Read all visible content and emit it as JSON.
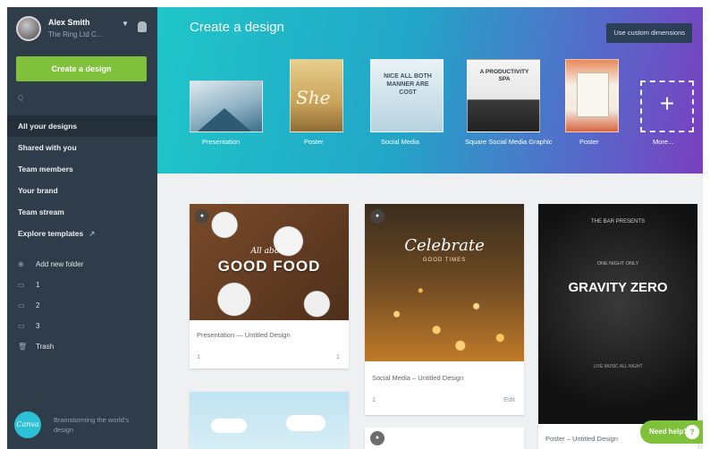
{
  "user": {
    "name": "Alex Smith",
    "team": "The Ring Ltd C..."
  },
  "sidebar": {
    "create_label": "Create a design",
    "search_text": "Q",
    "nav": [
      {
        "label": "All your designs",
        "active": true
      },
      {
        "label": "Shared with you"
      },
      {
        "label": "Team members"
      },
      {
        "label": "Your brand"
      },
      {
        "label": "Team stream"
      },
      {
        "label": "Explore templates",
        "arrow": "↗"
      }
    ],
    "folders": [
      {
        "icon": "⊕",
        "label": "Add new folder"
      },
      {
        "icon": "▭",
        "label": "1"
      },
      {
        "icon": "▭",
        "label": "2"
      },
      {
        "icon": "▭",
        "label": "3"
      },
      {
        "icon": "🗑",
        "label": "Trash"
      }
    ],
    "logo_text": "Canva",
    "promo_text": "Brainstorming the world’s design"
  },
  "header": {
    "title": "Create a design",
    "custom_dimensions_label": "Use custom dimensions",
    "templates": [
      {
        "label": "Presentation"
      },
      {
        "label": "Poster",
        "thumb_text": "She"
      },
      {
        "label": "Social Media",
        "thumb_text": "NICE ALL BOTH MANNER ARE COST"
      },
      {
        "label": "Square Social Media Graphic",
        "thumb_text": "A PRODUCTIVITY SPA"
      },
      {
        "label": "Poster"
      },
      {
        "label": "More...",
        "thumb_text": "+"
      }
    ]
  },
  "cards": {
    "food": {
      "small_text": "All about",
      "big_text": "GOOD FOOD",
      "title": "Presentation — Untitled Design",
      "left_meta": "1",
      "right_meta": "1"
    },
    "lantern": {
      "big_text": "Celebrate",
      "sub_text": "GOOD TIMES",
      "title": "Social Media – Untitled Design",
      "left_meta": "1",
      "right_meta": "Edit"
    },
    "gravity": {
      "top_text": "THE BAR PRESENTS",
      "mid_small": "ONE NIGHT ONLY",
      "big_text": "GRAVITY ZERO",
      "bottom_text": "LIVE MUSIC ALL NIGHT",
      "title": "Poster – Untitled Design"
    },
    "bottom_badge": "●"
  },
  "help": {
    "label": "Need help?",
    "q": "?"
  }
}
